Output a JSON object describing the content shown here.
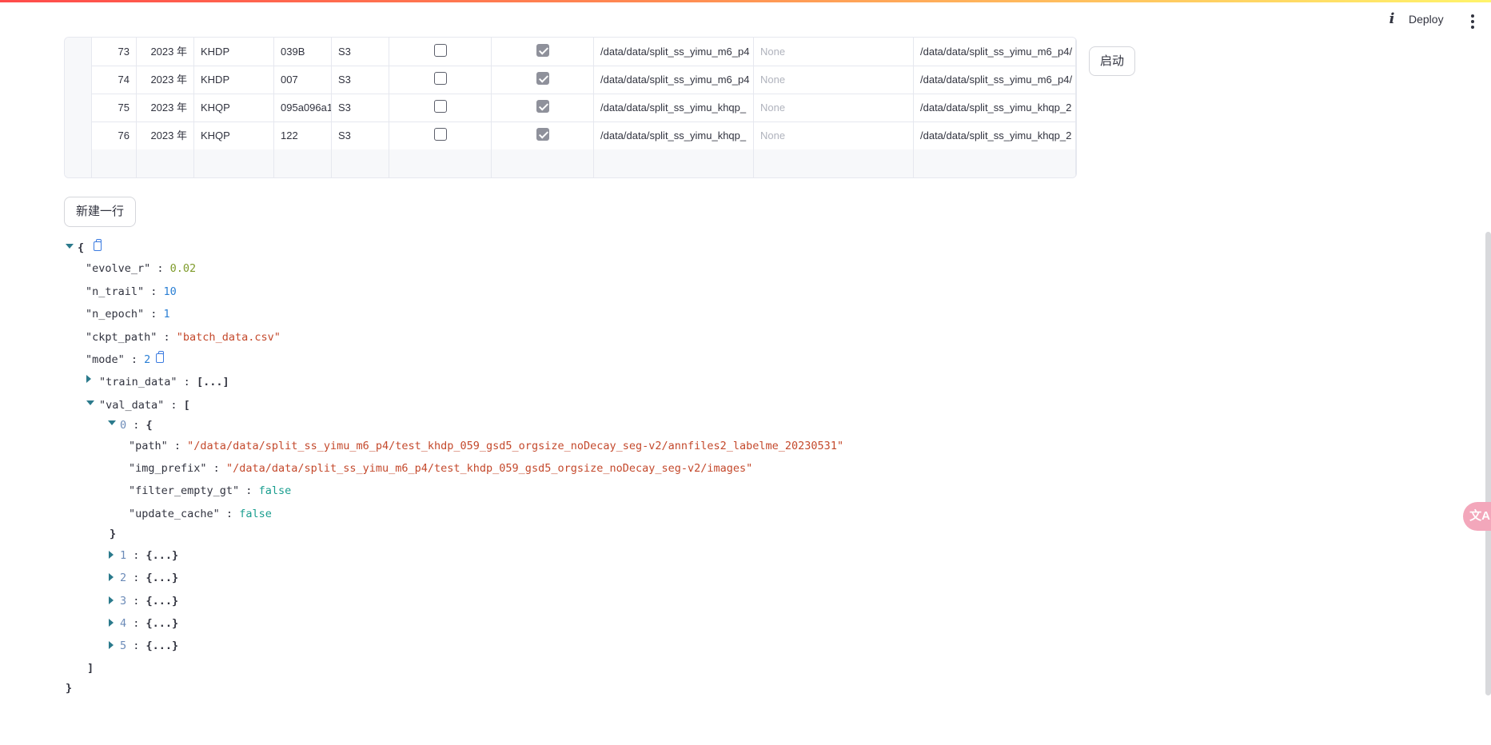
{
  "header": {
    "info_label": "i",
    "deploy_label": "Deploy"
  },
  "table": {
    "rows": [
      {
        "index": "73",
        "year": "2023 年",
        "type": "KHDP",
        "id": "039B",
        "stage": "S3",
        "check1": false,
        "check2": true,
        "path1": "/data/data/split_ss_yimu_m6_p4",
        "value": "None",
        "path2": "/data/data/split_ss_yimu_m6_p4/"
      },
      {
        "index": "74",
        "year": "2023 年",
        "type": "KHDP",
        "id": "007",
        "stage": "S3",
        "check1": false,
        "check2": true,
        "path1": "/data/data/split_ss_yimu_m6_p4",
        "value": "None",
        "path2": "/data/data/split_ss_yimu_m6_p4/"
      },
      {
        "index": "75",
        "year": "2023 年",
        "type": "KHQP",
        "id": "095a096a1",
        "stage": "S3",
        "check1": false,
        "check2": true,
        "path1": "/data/data/split_ss_yimu_khqp_",
        "value": "None",
        "path2": "/data/data/split_ss_yimu_khqp_2"
      },
      {
        "index": "76",
        "year": "2023 年",
        "type": "KHQP",
        "id": "122",
        "stage": "S3",
        "check1": false,
        "check2": true,
        "path1": "/data/data/split_ss_yimu_khqp_",
        "value": "None",
        "path2": "/data/data/split_ss_yimu_khqp_2"
      }
    ]
  },
  "buttons": {
    "start": "启动",
    "new_row": "新建一行"
  },
  "json_view": {
    "open_brace": "{",
    "close_brace": "}",
    "evolve_r_key": "\"evolve_r\"",
    "evolve_r_val": "0.02",
    "n_trail_key": "\"n_trail\"",
    "n_trail_val": "10",
    "n_epoch_key": "\"n_epoch\"",
    "n_epoch_val": "1",
    "ckpt_path_key": "\"ckpt_path\"",
    "ckpt_path_val": "\"batch_data.csv\"",
    "mode_key": "\"mode\"",
    "mode_val": "2",
    "train_data_key": "\"train_data\"",
    "collapsed_array": "[...]",
    "val_data_key": "\"val_data\"",
    "open_bracket": "[",
    "close_bracket": "]",
    "item0_key": "0",
    "item0_open": "{",
    "path_key": "\"path\"",
    "path_val": "\"/data/data/split_ss_yimu_m6_p4/test_khdp_059_gsd5_orgsize_noDecay_seg-v2/annfiles2_labelme_20230531\"",
    "img_prefix_key": "\"img_prefix\"",
    "img_prefix_val": "\"/data/data/split_ss_yimu_m6_p4/test_khdp_059_gsd5_orgsize_noDecay_seg-v2/images\"",
    "filter_empty_gt_key": "\"filter_empty_gt\"",
    "filter_empty_gt_val": "false",
    "update_cache_key": "\"update_cache\"",
    "update_cache_val": "false",
    "item_close": "}",
    "collapsed_items": [
      {
        "key": "1",
        "val": "{...}"
      },
      {
        "key": "2",
        "val": "{...}"
      },
      {
        "key": "3",
        "val": "{...}"
      },
      {
        "key": "4",
        "val": "{...}"
      },
      {
        "key": "5",
        "val": "{...}"
      }
    ]
  },
  "fab": {
    "label": "文A"
  },
  "colors": {
    "accent_red": "#ff4b4b",
    "string": "#c4492c",
    "number": "#2a7fd4",
    "boolean": "#1a9e8f",
    "checkbox_checked": "#8f919b"
  },
  "icons": [
    "info-icon",
    "more-vert-icon",
    "copy-icon",
    "expand-triangle-icon",
    "collapse-triangle-icon",
    "translate-icon"
  ]
}
